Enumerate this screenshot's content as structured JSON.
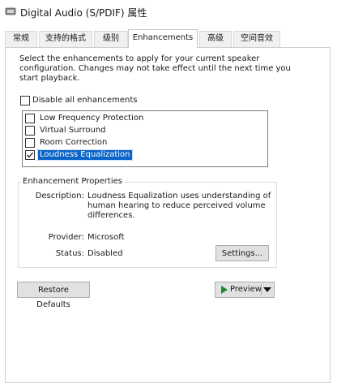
{
  "window": {
    "title": "Digital Audio (S/PDIF) 属性",
    "icon": "speaker-icon"
  },
  "tabs": [
    {
      "label": "常规",
      "active": false
    },
    {
      "label": "支持的格式",
      "active": false
    },
    {
      "label": "级别",
      "active": false
    },
    {
      "label": "Enhancements",
      "active": true
    },
    {
      "label": "高级",
      "active": false
    },
    {
      "label": "空间音效",
      "active": false
    }
  ],
  "enhancements": {
    "intro": "Select the enhancements to apply for your current speaker configuration. Changes may not take effect until the next time you start playback.",
    "disable_all": {
      "label": "Disable all enhancements",
      "checked": false
    },
    "items": [
      {
        "label": "Low Frequency Protection",
        "checked": false,
        "selected": false
      },
      {
        "label": "Virtual Surround",
        "checked": false,
        "selected": false
      },
      {
        "label": "Room Correction",
        "checked": false,
        "selected": false
      },
      {
        "label": "Loudness Equalization",
        "checked": true,
        "selected": true
      }
    ]
  },
  "properties": {
    "group_title": "Enhancement Properties",
    "description_label": "Description:",
    "description_lines": [
      "Loudness Equalization uses understanding of",
      "human hearing to reduce perceived volume",
      "differences."
    ],
    "provider_label": "Provider:",
    "provider_value": "Microsoft",
    "status_label": "Status:",
    "status_value": "Disabled",
    "settings_button": "Settings..."
  },
  "footer": {
    "restore_button": "Restore Defaults",
    "preview_button": "Preview"
  },
  "colors": {
    "selection": "#0a64c8",
    "play": "#1e8c2d"
  }
}
